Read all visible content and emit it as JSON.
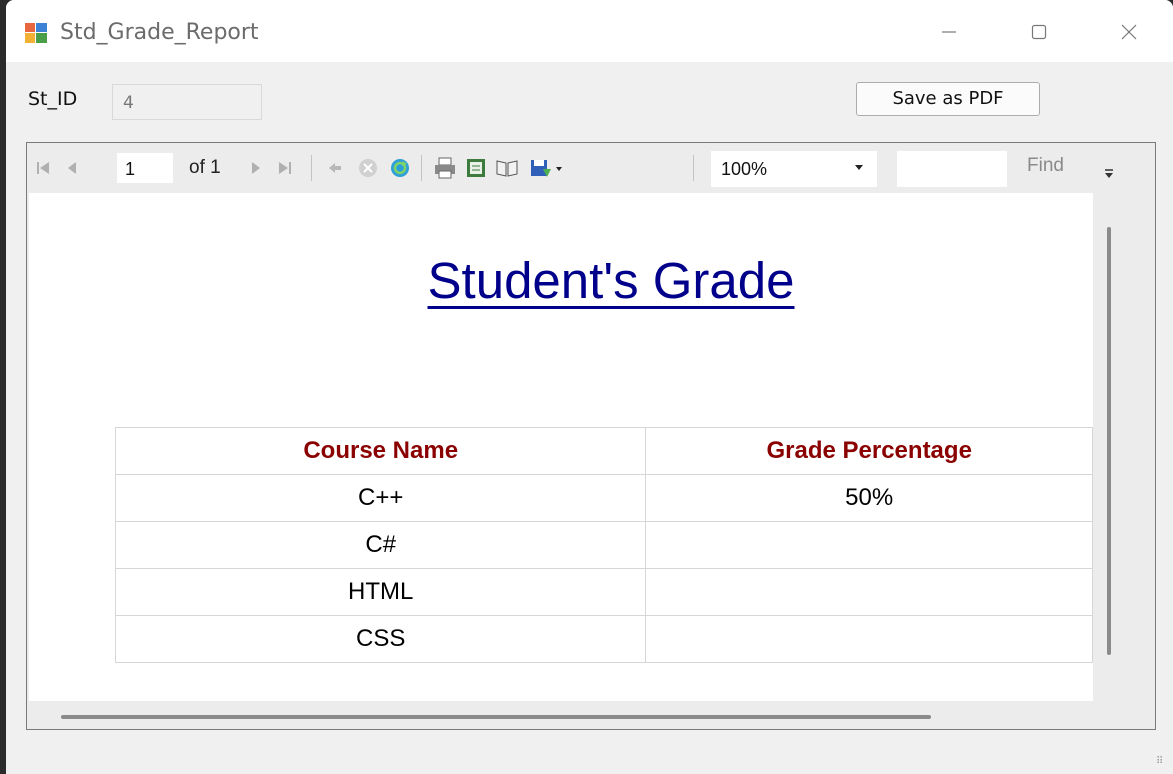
{
  "window": {
    "title": "Std_Grade_Report",
    "minimize_glyph": "—",
    "maximize_glyph": "☐",
    "close_glyph": "✕"
  },
  "form": {
    "st_id_label": "St_ID",
    "st_id_value": "4",
    "save_button": "Save as PDF"
  },
  "toolbar": {
    "current_page": "1",
    "of_pages": "of 1",
    "zoom": "100%",
    "find_label": "Find",
    "icons": [
      "first-page-icon",
      "previous-page-icon",
      "next-page-icon",
      "last-page-icon",
      "back-icon",
      "stop-icon",
      "refresh-icon",
      "print-icon",
      "print-layout-icon",
      "page-setup-icon",
      "export-icon"
    ]
  },
  "report": {
    "title": "Student's Grade",
    "headers": [
      "Course Name",
      "Grade Percentage"
    ],
    "rows": [
      [
        "C++",
        "50%"
      ],
      [
        "C#",
        ""
      ],
      [
        "HTML",
        ""
      ],
      [
        "CSS",
        ""
      ]
    ]
  },
  "colors": {
    "title": "#00008b",
    "header_text": "#8b0000"
  }
}
